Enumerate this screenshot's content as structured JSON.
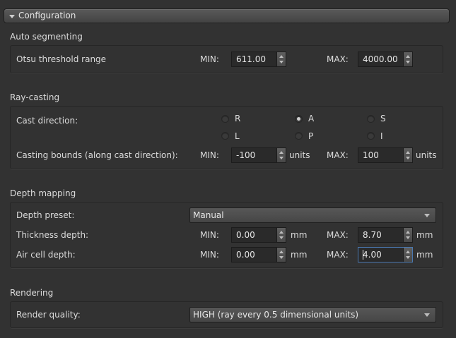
{
  "header": {
    "title": "Configuration"
  },
  "auto_segmenting": {
    "title": "Auto segmenting",
    "otsu_label": "Otsu threshold range",
    "min_label": "MIN:",
    "min_value": "611.00",
    "max_label": "MAX:",
    "max_value": "4000.00"
  },
  "ray_casting": {
    "title": "Ray-casting",
    "cast_direction_label": "Cast direction:",
    "directions": [
      {
        "label": "R",
        "checked": false
      },
      {
        "label": "A",
        "checked": true
      },
      {
        "label": "S",
        "checked": false
      },
      {
        "label": "L",
        "checked": false
      },
      {
        "label": "P",
        "checked": false
      },
      {
        "label": "I",
        "checked": false
      }
    ],
    "bounds_label": "Casting bounds (along cast direction):",
    "min_label": "MIN:",
    "min_value": "-100",
    "min_unit": "units",
    "max_label": "MAX:",
    "max_value": "100",
    "max_unit": "units"
  },
  "depth_mapping": {
    "title": "Depth mapping",
    "preset_label": "Depth preset:",
    "preset_value": "Manual",
    "thickness_label": "Thickness depth:",
    "thickness_min_label": "MIN:",
    "thickness_min_value": "0.00",
    "thickness_min_unit": "mm",
    "thickness_max_label": "MAX:",
    "thickness_max_value": "8.70",
    "thickness_max_unit": "mm",
    "aircell_label": "Air cell depth:",
    "aircell_min_label": "MIN:",
    "aircell_min_value": "0.00",
    "aircell_min_unit": "mm",
    "aircell_max_label": "MAX:",
    "aircell_max_value": "4.00",
    "aircell_max_unit": "mm"
  },
  "rendering": {
    "title": "Rendering",
    "quality_label": "Render quality:",
    "quality_value": "HIGH (ray every 0.5 dimensional units)"
  },
  "colors": {
    "background": "#323232",
    "focus_border": "#4a78b0"
  }
}
